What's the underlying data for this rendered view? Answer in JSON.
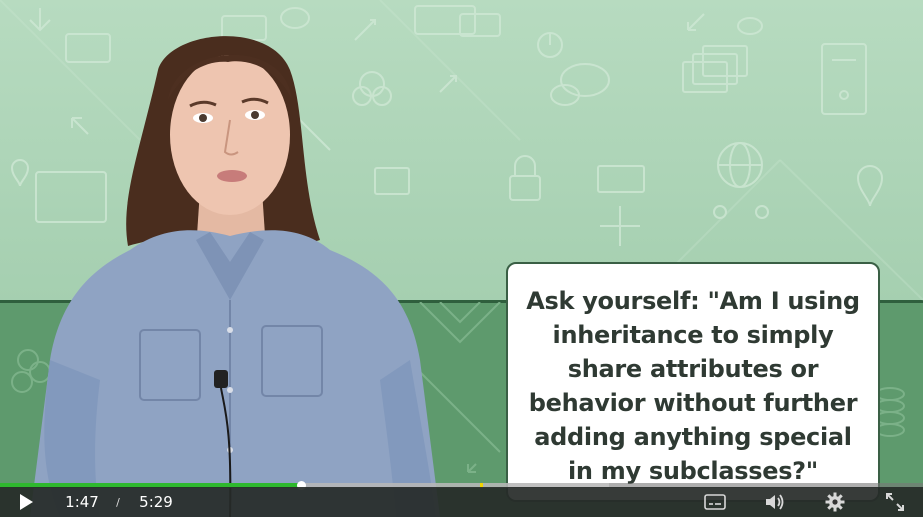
{
  "card": {
    "lines": [
      "Ask yourself: \"Am I using",
      "inheritance to simply",
      "share attributes or",
      "behavior without further",
      "adding anything special",
      "in my subclasses?\""
    ]
  },
  "controls": {
    "current_time": "1:47",
    "separator": "/",
    "duration": "5:29",
    "progress_fraction": 0.326,
    "buffered_fraction": 0.66,
    "marker_fraction": 0.52,
    "icons": {
      "play": "play-icon",
      "captions": "captions-icon",
      "volume": "volume-icon",
      "settings": "gear-icon",
      "fullscreen": "fullscreen-icon"
    }
  },
  "colors": {
    "played": "#2eb82e",
    "marker": "#f1d400",
    "background_top": "#a9d1b3",
    "background_bottom": "#5e9a6d"
  }
}
